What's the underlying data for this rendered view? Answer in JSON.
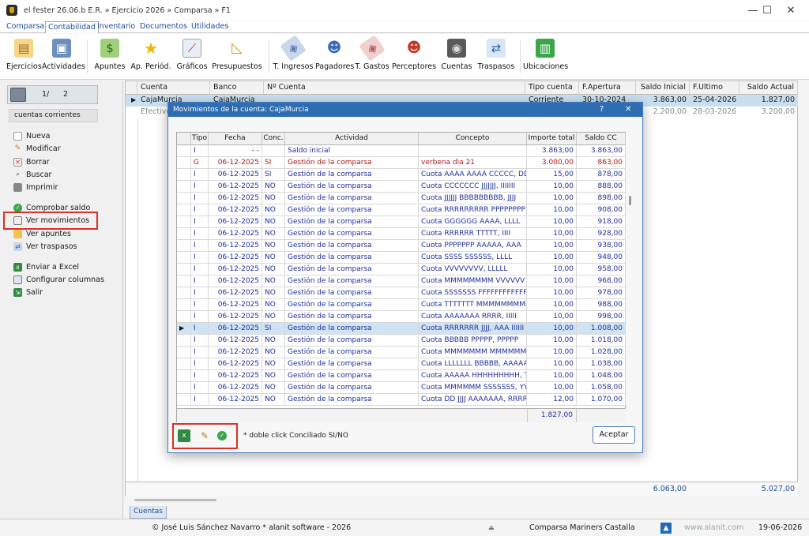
{
  "window": {
    "title": "el fester 26.06.b E.R. » Ejercicio 2026 » Comparsa » F1",
    "minimize": "—",
    "maximize": "☐",
    "close": "✕"
  },
  "menu": [
    "Comparsa",
    "Contabilidad",
    "Inventario",
    "Documentos",
    "Utilidades"
  ],
  "ribbon": [
    {
      "label": "Ejercicios",
      "icon": "cake-icon"
    },
    {
      "label": "Actividades",
      "icon": "briefcase-icon"
    },
    {
      "label": "Apuntes",
      "icon": "money-icon"
    },
    {
      "label": "Ap. Periód.",
      "icon": "star-icon"
    },
    {
      "label": "Gráficos",
      "icon": "chart-icon"
    },
    {
      "label": "Presupuestos",
      "icon": "triangle-ruler-icon"
    },
    {
      "label": "T. Ingresos",
      "icon": "tag-icon"
    },
    {
      "label": "Pagadores",
      "icon": "person-icon"
    },
    {
      "label": "T. Gastos",
      "icon": "tag-icon"
    },
    {
      "label": "Perceptores",
      "icon": "person-red-icon"
    },
    {
      "label": "Cuentas",
      "icon": "safe-icon"
    },
    {
      "label": "Traspasos",
      "icon": "transfer-icon"
    },
    {
      "label": "Ubicaciones",
      "icon": "cabinet-icon"
    }
  ],
  "sidebar": {
    "nav": {
      "current": "1/",
      "total": "2"
    },
    "header": "cuentas corrientes",
    "items": [
      {
        "label": "Nueva",
        "icon": "new-doc-icon"
      },
      {
        "label": "Modificar",
        "icon": "edit-icon"
      },
      {
        "label": "Borrar",
        "icon": "delete-icon"
      },
      {
        "label": "Buscar",
        "icon": "search-icon"
      },
      {
        "label": "Imprimir",
        "icon": "print-icon"
      },
      {
        "label": "Comprobar saldo",
        "icon": "check-icon"
      },
      {
        "label": "Ver movimientos",
        "icon": "movements-icon"
      },
      {
        "label": "Ver apuntes",
        "icon": "entries-icon"
      },
      {
        "label": "Ver traspasos",
        "icon": "transfers-icon"
      },
      {
        "label": "Enviar a Excel",
        "icon": "excel-icon"
      },
      {
        "label": "Configurar columnas",
        "icon": "columns-icon"
      },
      {
        "label": "Salir",
        "icon": "exit-icon"
      }
    ]
  },
  "accounts": {
    "columns": [
      "Cuenta",
      "Banco",
      "Nº Cuenta",
      "Tipo cuenta",
      "F.Apertura",
      "Saldo Inicial",
      "F.Ultimo",
      "Saldo Actual"
    ],
    "rows": [
      {
        "cuenta": "CajaMurcia",
        "banco": "CajaMurcia",
        "numero": "",
        "tipo": "Corriente",
        "apertura": "30-10-2024",
        "saldo_inicial": "3.863,00",
        "ultimo": "25-04-2026",
        "saldo_actual": "1.827,00"
      },
      {
        "cuenta": "Efectivo",
        "banco": "",
        "numero": "",
        "tipo": "",
        "apertura": "",
        "saldo_inicial": "2.200,00",
        "ultimo": "28-03-2026",
        "saldo_actual": "3.200,00"
      }
    ],
    "totals": {
      "saldo_inicial": "6.063,00",
      "saldo_actual": "5.027,00"
    },
    "tab": "Cuentas"
  },
  "dialog": {
    "title": "Movimientos de la cuenta: CajaMurcia",
    "help": "?",
    "close": "✕",
    "columns": [
      "Tipo",
      "Fecha",
      "Conc.",
      "Actividad",
      "Concepto",
      "Importe total",
      "Saldo CC"
    ],
    "rows": [
      {
        "tipo": "I",
        "fecha": "- -",
        "conc": "",
        "actividad": "Saldo inicial",
        "concepto": "",
        "importe": "3.863,00",
        "saldo": "3.863,00",
        "color": "blue"
      },
      {
        "tipo": "G",
        "fecha": "06-12-2025",
        "conc": "SI",
        "actividad": "Gestión de la comparsa",
        "concepto": "verbena dia 21",
        "importe": "3.000,00",
        "saldo": "863,00",
        "color": "red"
      },
      {
        "tipo": "I",
        "fecha": "06-12-2025",
        "conc": "SI",
        "actividad": "Gestión de la comparsa",
        "concepto": "Cuota AAAA AAAA CCCCC, DDDD",
        "importe": "15,00",
        "saldo": "878,00",
        "color": "blue"
      },
      {
        "tipo": "I",
        "fecha": "06-12-2025",
        "conc": "NO",
        "actividad": "Gestión de la comparsa",
        "concepto": "Cuota CCCCCCC JJJJJJJ, IIIIIII",
        "importe": "10,00",
        "saldo": "888,00",
        "color": "blue"
      },
      {
        "tipo": "I",
        "fecha": "06-12-2025",
        "conc": "NO",
        "actividad": "Gestión de la comparsa",
        "concepto": "Cuota JJJJJJ BBBBBBBBB, JJJJ",
        "importe": "10,00",
        "saldo": "898,00",
        "color": "blue"
      },
      {
        "tipo": "I",
        "fecha": "06-12-2025",
        "conc": "NO",
        "actividad": "Gestión de la comparsa",
        "concepto": "Cuota RRRRRRRRR PPPPPPPP, LLL",
        "importe": "10,00",
        "saldo": "908,00",
        "color": "blue"
      },
      {
        "tipo": "I",
        "fecha": "06-12-2025",
        "conc": "NO",
        "actividad": "Gestión de la comparsa",
        "concepto": "Cuota GGGGGG AAAA, LLLL",
        "importe": "10,00",
        "saldo": "918,00",
        "color": "blue"
      },
      {
        "tipo": "I",
        "fecha": "06-12-2025",
        "conc": "NO",
        "actividad": "Gestión de la comparsa",
        "concepto": "Cuota RRRRRR TTTTT, IIII",
        "importe": "10,00",
        "saldo": "928,00",
        "color": "blue"
      },
      {
        "tipo": "I",
        "fecha": "06-12-2025",
        "conc": "NO",
        "actividad": "Gestión de la comparsa",
        "concepto": "Cuota PPPPPPP AAAAA, AAA",
        "importe": "10,00",
        "saldo": "938,00",
        "color": "blue"
      },
      {
        "tipo": "I",
        "fecha": "06-12-2025",
        "conc": "NO",
        "actividad": "Gestión de la comparsa",
        "concepto": "Cuota SSSS SSSSSS, LLLL",
        "importe": "10,00",
        "saldo": "948,00",
        "color": "blue"
      },
      {
        "tipo": "I",
        "fecha": "06-12-2025",
        "conc": "NO",
        "actividad": "Gestión de la comparsa",
        "concepto": "Cuota VVVVVVVV, LLLLL",
        "importe": "10,00",
        "saldo": "958,00",
        "color": "blue"
      },
      {
        "tipo": "I",
        "fecha": "06-12-2025",
        "conc": "NO",
        "actividad": "Gestión de la comparsa",
        "concepto": "Cuota MMMMMMMM VVVVVV",
        "importe": "10,00",
        "saldo": "968,00",
        "color": "blue"
      },
      {
        "tipo": "I",
        "fecha": "06-12-2025",
        "conc": "NO",
        "actividad": "Gestión de la comparsa",
        "concepto": "Cuota SSSSSSS FFFFFFFFFFFFF, I",
        "importe": "10,00",
        "saldo": "978,00",
        "color": "blue"
      },
      {
        "tipo": "I",
        "fecha": "06-12-2025",
        "conc": "NO",
        "actividad": "Gestión de la comparsa",
        "concepto": "Cuota TTTTTTT MMMMMMMMM",
        "importe": "10,00",
        "saldo": "988,00",
        "color": "blue"
      },
      {
        "tipo": "I",
        "fecha": "06-12-2025",
        "conc": "NO",
        "actividad": "Gestión de la comparsa",
        "concepto": "Cuota AAAAAAA RRRR, IIIII",
        "importe": "10,00",
        "saldo": "998,00",
        "color": "blue"
      },
      {
        "tipo": "I",
        "fecha": "06-12-2025",
        "conc": "SI",
        "actividad": "Gestión de la comparsa",
        "concepto": "Cuota RRRRRRR JJJJ, AAA IIIIII",
        "importe": "10,00",
        "saldo": "1.008,00",
        "color": "blue",
        "selected": true
      },
      {
        "tipo": "I",
        "fecha": "06-12-2025",
        "conc": "NO",
        "actividad": "Gestión de la comparsa",
        "concepto": "Cuota BBBBB PPPPP, PPPPP",
        "importe": "10,00",
        "saldo": "1.018,00",
        "color": "blue"
      },
      {
        "tipo": "I",
        "fecha": "06-12-2025",
        "conc": "NO",
        "actividad": "Gestión de la comparsa",
        "concepto": "Cuota MMMMMMM MMMMMMM",
        "importe": "10,00",
        "saldo": "1.028,00",
        "color": "blue"
      },
      {
        "tipo": "I",
        "fecha": "06-12-2025",
        "conc": "NO",
        "actividad": "Gestión de la comparsa",
        "concepto": "Cuota LLLLLLL BBBBB, AAAAAA",
        "importe": "10,00",
        "saldo": "1.038,00",
        "color": "blue"
      },
      {
        "tipo": "I",
        "fecha": "06-12-2025",
        "conc": "NO",
        "actividad": "Gestión de la comparsa",
        "concepto": "Cuota AAAAA HHHHHHHHH, T",
        "importe": "10,00",
        "saldo": "1.048,00",
        "color": "blue"
      },
      {
        "tipo": "I",
        "fecha": "06-12-2025",
        "conc": "NO",
        "actividad": "Gestión de la comparsa",
        "concepto": "Cuota MMMMMM SSSSSSS, YY",
        "importe": "10,00",
        "saldo": "1.058,00",
        "color": "blue"
      },
      {
        "tipo": "I",
        "fecha": "06-12-2025",
        "conc": "NO",
        "actividad": "Gestión de la comparsa",
        "concepto": "Cuota DD JJJJ AAAAAAA, RRRRI",
        "importe": "12,00",
        "saldo": "1.070,00",
        "color": "blue"
      }
    ],
    "total": "1.827,00",
    "hint": "* doble click Conciliado SI/NO",
    "accept": "Aceptar",
    "tools": [
      "excel-icon",
      "edit-icon",
      "check-icon"
    ]
  },
  "status": {
    "author": "© José Luis Sánchez Navarro  * alanit software - 2026",
    "org": "Comparsa Mariners Castalla",
    "web": "www.alanit.com",
    "date": "19-06-2026"
  },
  "colors": {
    "title_blue": "#2f6db3",
    "link_blue": "#1d4c9c",
    "income_blue": "#1f2f9c",
    "expense_red": "#b01818",
    "highlight_red": "#d9302a",
    "selected_row": "#cfe3f5"
  }
}
